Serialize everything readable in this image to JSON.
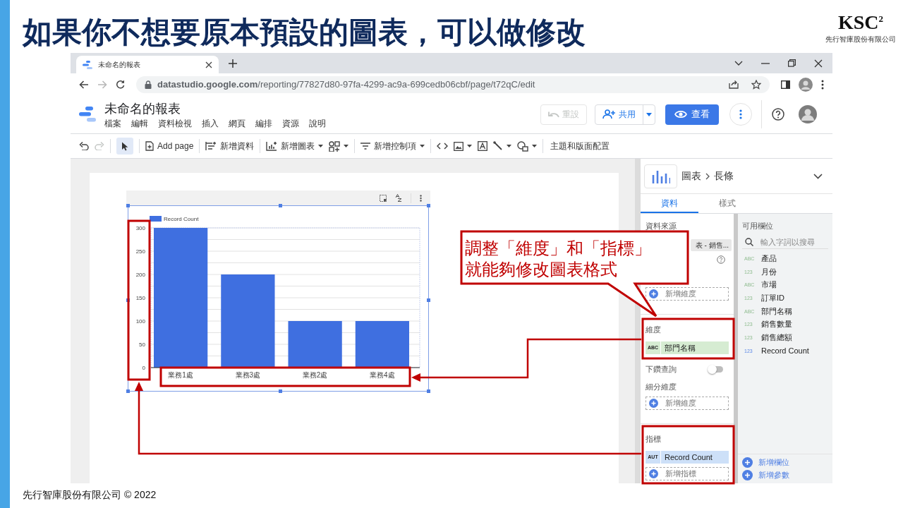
{
  "slide": {
    "title": "如果你不想要原本預設的圖表，可以做修改",
    "logo": {
      "mark": "KSC$^{2}$",
      "caption": "先行智庫股份有限公司"
    },
    "footer": "先行智庫股份有限公司 © 2022"
  },
  "browser": {
    "tabs": [
      {
        "label": "未命名的報表",
        "selected": true
      }
    ],
    "forward_disabled": true,
    "url": "**datastudio.google.com**/reporting/77827d80-97fa-4299-ac9a-699cedb06cbf/page/t72qC/edit"
  },
  "app": {
    "title": "未命名的報表",
    "menu": [
      "檔案",
      "編輯",
      "資料檢視",
      "插入",
      "網頁",
      "編排",
      "資源",
      "說明"
    ],
    "reset": {
      "label": "重設",
      "disabled": true
    },
    "share": "共用",
    "view": "查看"
  },
  "toolbar": {
    "redo_disabled": true,
    "pointer_selected": true,
    "add_page": "Add page",
    "add_data": "新增資料",
    "add_chart": "新增圖表",
    "add_control": "新增控制項",
    "theme": "主題和版面配置"
  },
  "report": {
    "chart_data": {
      "type": "bar",
      "categories": [
        "業務1處",
        "業務3處",
        "業務2處",
        "業務4處"
      ],
      "series": [
        {
          "name": "Record Count",
          "color": "#3f6fe0",
          "values": [
            300,
            200,
            100,
            100
          ]
        }
      ],
      "ylim": [
        0,
        300
      ],
      "yticks": [
        0,
        50,
        100,
        150,
        200,
        250,
        300
      ],
      "grid": true
    }
  },
  "panel": {
    "breadcrumb": {
      "category": "圖表",
      "chart_type": "長條"
    },
    "tabs": [
      {
        "label": "資料",
        "selected": true
      },
      {
        "label": "樣式",
        "selected": false
      }
    ],
    "data_source": {
      "label": "資料來源",
      "value": "表 - 銷售..."
    },
    "add_dimension": "新增維度",
    "dimension": {
      "label": "維度",
      "chips": [
        {
          "type": "ABC",
          "name": "部門名稱"
        }
      ]
    },
    "drill_down": {
      "label": "下鑽查詢",
      "on": false
    },
    "breakdown": {
      "label": "細分維度",
      "add": "新增維度"
    },
    "metric": {
      "label": "指標",
      "chips": [
        {
          "type": "AUT",
          "name": "Record Count"
        }
      ],
      "add": "新增指標"
    },
    "fields": {
      "label": "可用欄位",
      "placeholder": "輸入字詞以搜尋",
      "items": [
        {
          "type": "ABC",
          "name": "產品",
          "kind": "dimension"
        },
        {
          "type": "123",
          "name": "月份",
          "kind": "dimension"
        },
        {
          "type": "ABC",
          "name": "市場",
          "kind": "dimension"
        },
        {
          "type": "123",
          "name": "訂單ID",
          "kind": "dimension"
        },
        {
          "type": "ABC",
          "name": "部門名稱",
          "kind": "dimension"
        },
        {
          "type": "123",
          "name": "銷售數量",
          "kind": "dimension"
        },
        {
          "type": "123",
          "name": "銷售總額",
          "kind": "dimension"
        },
        {
          "type": "123",
          "name": "Record Count",
          "kind": "metric"
        }
      ],
      "add_field": "新增欄位",
      "add_parameter": "新增參數"
    }
  },
  "annotation": {
    "callout_lines": [
      "調整「維度」和「指標」",
      "就能夠修改圖表格式"
    ]
  }
}
